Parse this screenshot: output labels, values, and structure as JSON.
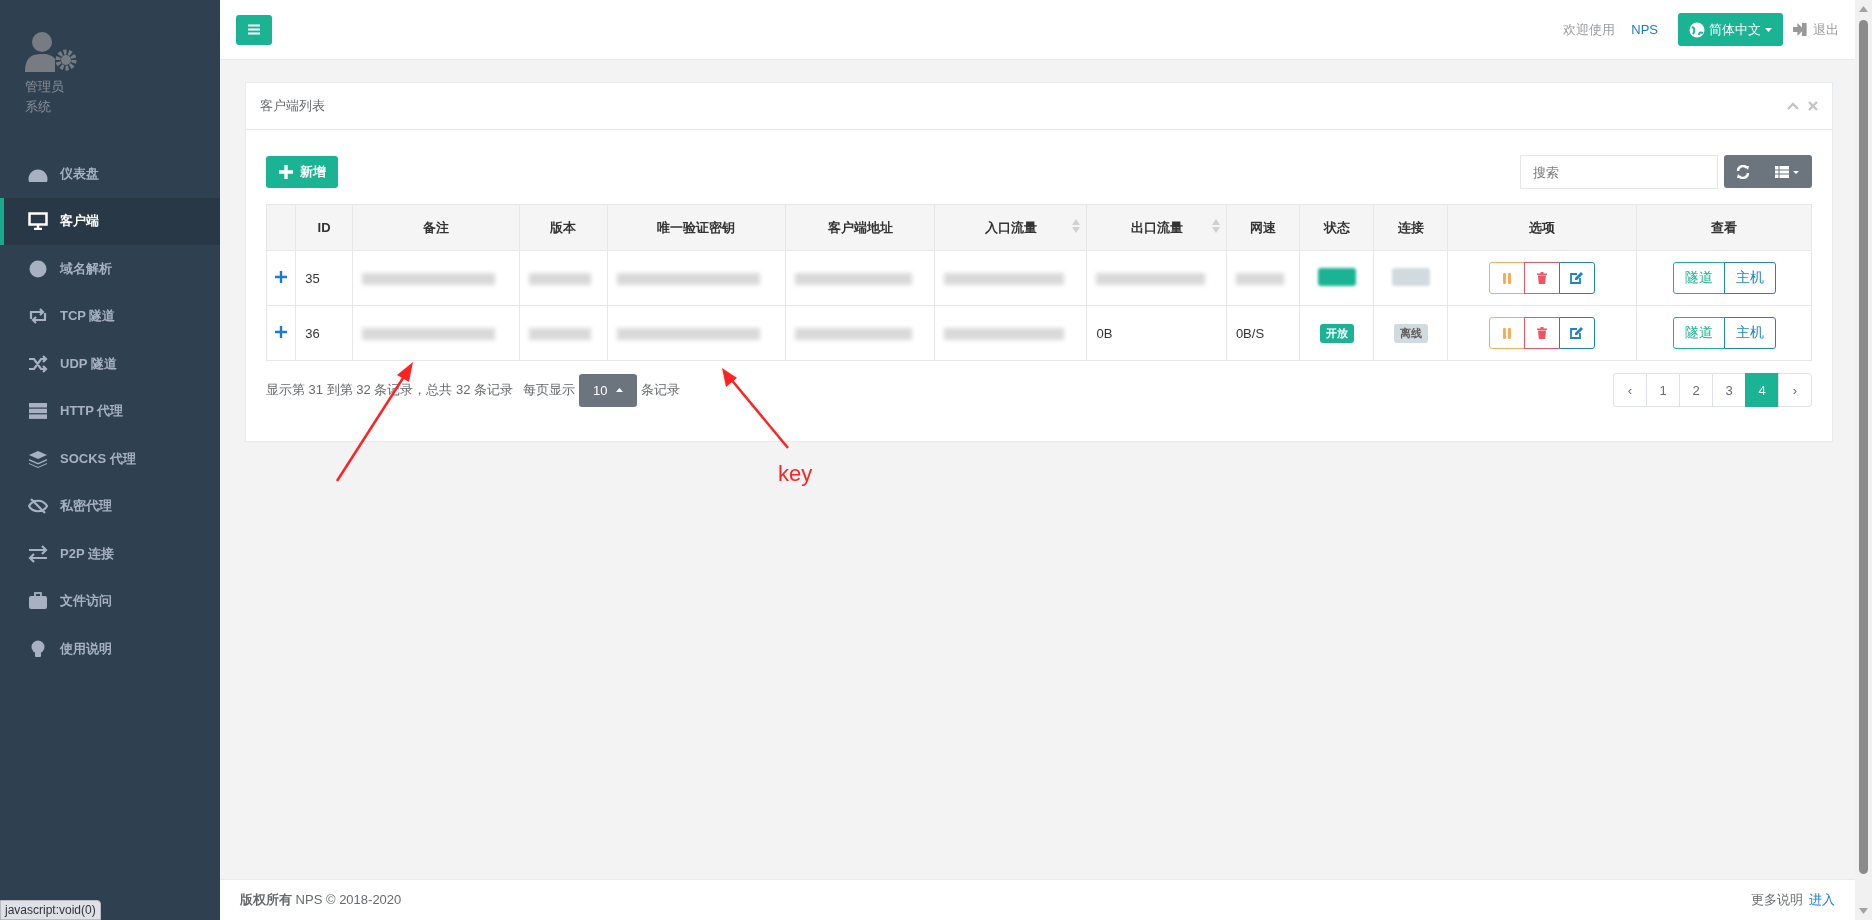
{
  "sidebar": {
    "profile": {
      "name": "管理员",
      "role": "系统"
    },
    "items": [
      {
        "label": "仪表盘",
        "selected": false
      },
      {
        "label": "客户端",
        "selected": true
      },
      {
        "label": "域名解析",
        "selected": false
      },
      {
        "label": "TCP 隧道",
        "selected": false
      },
      {
        "label": "UDP 隧道",
        "selected": false
      },
      {
        "label": "HTTP 代理",
        "selected": false
      },
      {
        "label": "SOCKS 代理",
        "selected": false
      },
      {
        "label": "私密代理",
        "selected": false
      },
      {
        "label": "P2P 连接",
        "selected": false
      },
      {
        "label": "文件访问",
        "selected": false
      },
      {
        "label": "使用说明",
        "selected": false
      }
    ]
  },
  "header": {
    "welcome": "欢迎使用",
    "brand": "NPS",
    "language": "简体中文",
    "logout": "退出"
  },
  "card": {
    "title": "客户端列表",
    "add_button": "新增",
    "search": {
      "placeholder": "搜索"
    },
    "table": {
      "columns": [
        {
          "label": "ID",
          "sortable": false
        },
        {
          "label": "备注",
          "sortable": false
        },
        {
          "label": "版本",
          "sortable": false
        },
        {
          "label": "唯一验证密钥",
          "sortable": false
        },
        {
          "label": "客户端地址",
          "sortable": false
        },
        {
          "label": "入口流量",
          "sortable": true
        },
        {
          "label": "出口流量",
          "sortable": true
        },
        {
          "label": "网速",
          "sortable": false
        },
        {
          "label": "状态",
          "sortable": false
        },
        {
          "label": "连接",
          "sortable": false
        },
        {
          "label": "选项",
          "sortable": false
        },
        {
          "label": "查看",
          "sortable": false
        }
      ],
      "rows": [
        {
          "cells": [
            {
              "text": "35",
              "blurred": false
            },
            {
              "blurred": true
            },
            {
              "blurred": true
            },
            {
              "blurred": true
            },
            {
              "blurred": true
            },
            {
              "blurred": true
            },
            {
              "blurred": true
            },
            {
              "blurred": true
            }
          ],
          "status": {
            "blurred": true,
            "color": "#1ab394"
          },
          "connection": {
            "blurred": true,
            "color": "#d1dade"
          },
          "views": [
            "隧道",
            "主机"
          ]
        },
        {
          "cells": [
            {
              "text": "36",
              "blurred": false
            },
            {
              "blurred": true
            },
            {
              "blurred": true
            },
            {
              "blurred": true
            },
            {
              "blurred": true
            },
            {
              "blurred": true
            },
            {
              "text": "0B",
              "blurred": false
            },
            {
              "text": "0B/S",
              "blurred": false
            }
          ],
          "status": {
            "blurred": false,
            "label": "开放",
            "color": "#1ab394"
          },
          "connection": {
            "blurred": false,
            "label": "离线",
            "color": "#d1dade"
          },
          "views": [
            "隧道",
            "主机"
          ]
        }
      ]
    },
    "pagination": {
      "info": "显示第 31 到第 32 条记录，总共 32 条记录",
      "per_page_label": "每页显示",
      "page_size": "10",
      "per_page_suffix": "条记录",
      "pages": [
        {
          "label": "‹",
          "selected": false
        },
        {
          "label": "1",
          "selected": false
        },
        {
          "label": "2",
          "selected": false
        },
        {
          "label": "3",
          "selected": false
        },
        {
          "label": "4",
          "selected": true
        },
        {
          "label": "›",
          "selected": false
        }
      ]
    }
  },
  "annotations": {
    "label": "key"
  },
  "footer": {
    "copyright": "**版权所有** NPS © 2018-2020",
    "more": "更多说明",
    "enter": "进入"
  },
  "browser_status": "javascript:void(0)"
}
